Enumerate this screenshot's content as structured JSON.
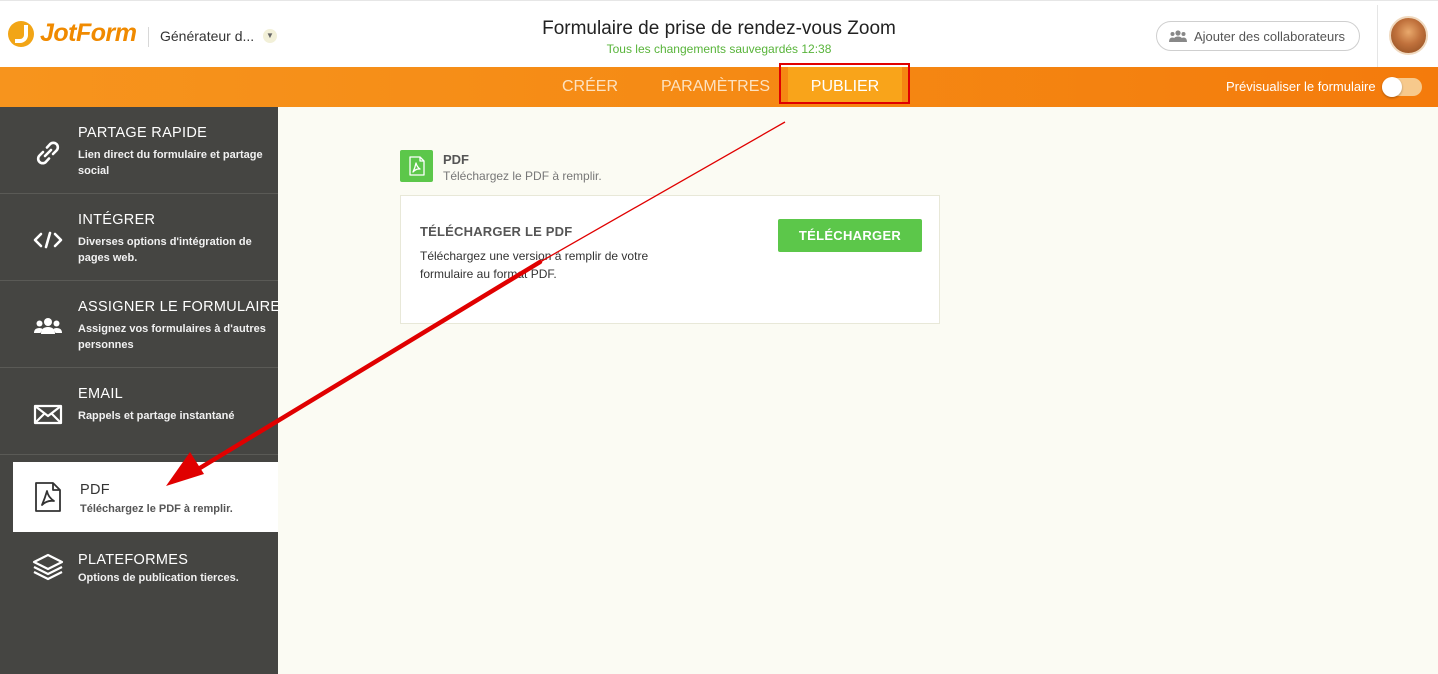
{
  "header": {
    "logo_text": "JotForm",
    "builder_name": "Générateur d...",
    "form_title": "Formulaire de prise de rendez-vous Zoom",
    "save_status": "Tous les changements sauvegardés 12:38",
    "collab_label": "Ajouter des collaborateurs"
  },
  "nav": {
    "tabs": [
      {
        "label": "CRÉER"
      },
      {
        "label": "PARAMÈTRES"
      },
      {
        "label": "PUBLIER",
        "active": true
      }
    ],
    "preview_label": "Prévisualiser le formulaire",
    "preview_on": false
  },
  "sidebar": {
    "items": [
      {
        "title": "PARTAGE RAPIDE",
        "desc": "Lien direct du formulaire et partage social",
        "icon": "link-icon"
      },
      {
        "title": "INTÉGRER",
        "desc": "Diverses options d'intégration de pages web.",
        "icon": "code-icon"
      },
      {
        "title": "ASSIGNER LE FORMULAIRE",
        "desc": "Assignez vos formulaires à d'autres personnes",
        "icon": "users-icon"
      },
      {
        "title": "EMAIL",
        "desc": "Rappels et partage instantané",
        "icon": "envelope-icon"
      },
      {
        "title": "PDF",
        "desc": "Téléchargez le PDF à remplir.",
        "icon": "pdf-icon",
        "active": true
      },
      {
        "title": "PLATEFORMES",
        "desc": "Options de publication tierces.",
        "icon": "layers-icon"
      }
    ]
  },
  "main": {
    "section_title": "PDF",
    "section_desc": "Téléchargez le PDF à remplir.",
    "card": {
      "title": "TÉLÉCHARGER LE PDF",
      "desc": "Téléchargez une version à remplir de votre formulaire au format PDF.",
      "button_label": "TÉLÉCHARGER"
    }
  },
  "colors": {
    "brand_orange": "#f58a14",
    "accent_green": "#5cc74a",
    "sidebar_bg": "#454542",
    "annotation_red": "#e00000"
  }
}
